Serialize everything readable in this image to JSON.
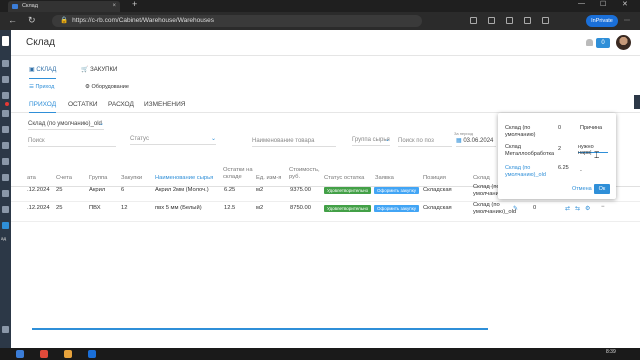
{
  "browser": {
    "tab_title": "Склад",
    "tab_close": "×",
    "new_tab": "+",
    "url": "https://c-rb.com/Cabinet/Warehouse/Warehouses",
    "inprivate_label": "InPrivate",
    "win_min": "—",
    "win_max": "☐",
    "win_close": "✕",
    "back": "←",
    "reload": "↻"
  },
  "header": {
    "title": "Склад",
    "notification_count": "0"
  },
  "rail": {
    "text_label": "ад"
  },
  "modules": {
    "tabs": [
      {
        "label": "СКЛАД",
        "icon": "box-icon"
      },
      {
        "label": "ЗАКУПКИ",
        "icon": "cart-icon"
      }
    ]
  },
  "subtabs": [
    {
      "label": "Приход",
      "icon": "list-icon"
    },
    {
      "label": "Оборудование",
      "icon": "gear-icon"
    }
  ],
  "operations": [
    "ПРИХОД",
    "ОСТАТКИ",
    "РАСХОД",
    "ИЗМЕНЕНИЯ"
  ],
  "filters": {
    "warehouse_select": "Склад (по умолчанию)_old",
    "search_placeholder": "Поиск",
    "status_placeholder": "Статус",
    "product_name_placeholder": "Наименование товара",
    "material_group_placeholder": "Группа сырья",
    "search_by_position_placeholder": "Поиск по поз",
    "date_period_label": "За период",
    "date_value": "03.06.2024"
  },
  "table": {
    "headers": [
      "ата",
      "Счета",
      "Группа",
      "Закупки",
      "Наименование сырья",
      "Остатки на складе",
      "Ед. изм-я",
      "Стоимость, руб.",
      "Статус остатка",
      "Заявка",
      "Позиция",
      "Склад"
    ],
    "rows": [
      {
        "date": ".12.2024",
        "invoice": "25",
        "group": "Акрил",
        "purchases": "6",
        "material": "Акрил 2мм (Молоч.)",
        "stock": "6.25",
        "unit": "м2",
        "cost": "9375.00",
        "status": "Удовлетворительно",
        "request": "Оформить закупку",
        "position": "Складская",
        "warehouse": "Склад (по умолчанию)_old",
        "extra": "0"
      },
      {
        "date": ".12.2024",
        "invoice": "25",
        "group": "ПВХ",
        "purchases": "12",
        "material": "пвх 5 мм (Белый)",
        "stock": "12.5",
        "unit": "м2",
        "cost": "8750.00",
        "status": "Удовлетворительно",
        "request": "Оформить закупку",
        "position": "Складская",
        "warehouse": "Склад (по умолчанию)_old",
        "extra": "0"
      }
    ]
  },
  "popup": {
    "rows": [
      {
        "name": "Склад (по умолчанию)",
        "qty": "0",
        "note": "Причина"
      },
      {
        "name": "Склад Металлообработка",
        "qty": "2",
        "note": "нужно нарв|"
      },
      {
        "name": "Склад (по умолчанию)_old",
        "qty": "6.25",
        "note": "-"
      }
    ],
    "cancel_label": "Отмена",
    "ok_label": "Ок"
  },
  "taskbar": {
    "time": "8:39"
  },
  "colors": {
    "accent": "#2f8fd8",
    "status_ok": "#43a047",
    "order_button": "#42a5f5",
    "sidebar": "#2c3847"
  }
}
